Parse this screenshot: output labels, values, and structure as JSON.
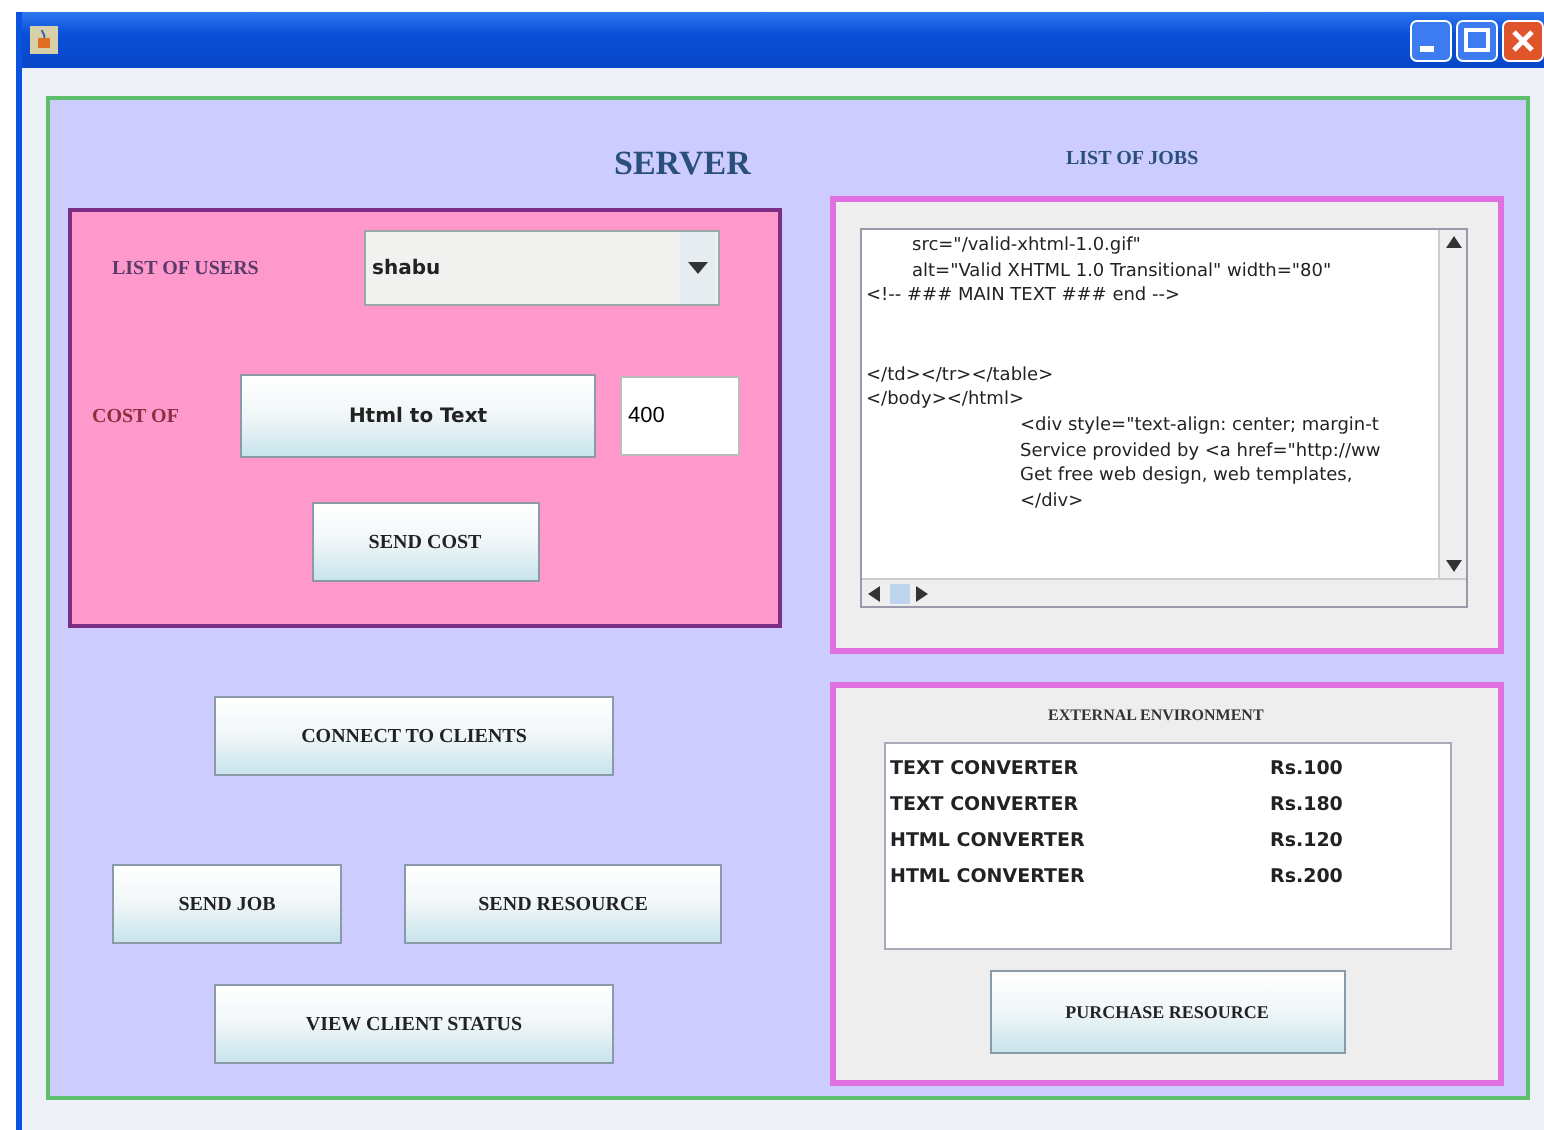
{
  "server_title": "SERVER",
  "users": {
    "label": "LIST OF USERS",
    "value": "shabu"
  },
  "cost": {
    "label": "COST OF",
    "service_button": "Html to Text",
    "amount": "400"
  },
  "send_cost_button": "SEND COST",
  "buttons": [
    {
      "label": "CONNECT TO CLIENTS",
      "kind": "wide"
    },
    {
      "label": "SEND JOB",
      "kind": "pair"
    },
    {
      "label": "SEND RESOURCE",
      "kind": "pair"
    },
    {
      "label": "VIEW CLIENT STATUS",
      "kind": "wide"
    }
  ],
  "jobs": {
    "title": "LIST OF JOBS",
    "lines": [
      {
        "text": "src=\"/valid-xhtml-1.0.gif\"",
        "kind": "indent1"
      },
      {
        "text": "alt=\"Valid XHTML 1.0 Transitional\" width=\"80\"",
        "kind": "indent1"
      },
      {
        "text": "<!-- ### MAIN TEXT ### end -->",
        "kind": "plain"
      },
      {
        "text": "</td></tr></table>",
        "kind": "gap"
      },
      {
        "text": "</body></html>",
        "kind": "plain"
      },
      {
        "text": "<div style=\"text-align: center; margin-t",
        "kind": "indent2"
      },
      {
        "text": "Service provided by <a href=\"http://ww",
        "kind": "indent2"
      },
      {
        "text": "Get free web design, web templates,",
        "kind": "indent2"
      },
      {
        "text": "</div>",
        "kind": "indent2"
      }
    ]
  },
  "external": {
    "title": "EXTERNAL ENVIRONMENT",
    "rows": [
      {
        "name": "TEXT CONVERTER",
        "price": "Rs.100"
      },
      {
        "name": "TEXT CONVERTER",
        "price": "Rs.180"
      },
      {
        "name": "HTML CONVERTER",
        "price": "Rs.120"
      },
      {
        "name": "HTML CONVERTER",
        "price": "Rs.200"
      }
    ],
    "button": "PURCHASE RESOURCE"
  }
}
